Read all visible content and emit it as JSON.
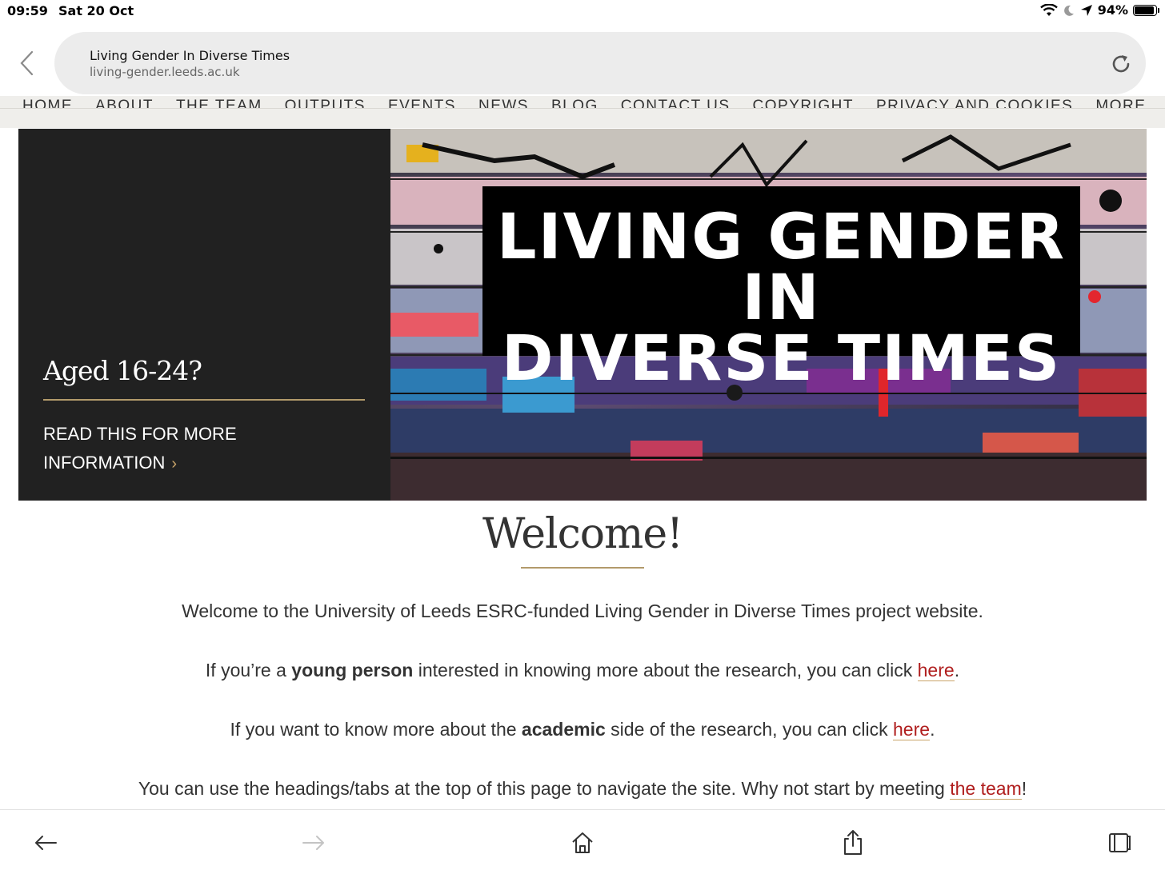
{
  "status_bar": {
    "time": "09:59",
    "date": "Sat 20 Oct",
    "battery": "94%",
    "battery_level": 0.94
  },
  "browser": {
    "page_title": "Living Gender In Diverse Times",
    "host": "living-gender.leeds.ac.uk"
  },
  "nav": {
    "items": [
      "HOME",
      "ABOUT",
      "THE TEAM",
      "OUTPUTS",
      "EVENTS",
      "NEWS",
      "BLOG",
      "CONTACT US",
      "COPYRIGHT",
      "PRIVACY AND COOKIES",
      "MORE"
    ]
  },
  "hero": {
    "aged": "Aged 16-24?",
    "cta_line1": "READ THIS FOR MORE",
    "cta_line2": "INFORMATION",
    "banner_line1": "LIVING GENDER IN",
    "banner_line2": "DIVERSE TIMES"
  },
  "welcome": {
    "title": "Welcome!",
    "p1": "Welcome to the University of Leeds ESRC-funded Living Gender in Diverse Times project website.",
    "p2_pre": "If you’re a ",
    "p2_bold": "young person",
    "p2_mid": " interested in knowing more about the research, you can click ",
    "p2_link": "here",
    "p2_post": ".",
    "p3_pre": "If you want to know more about the ",
    "p3_bold": "academic",
    "p3_mid": " side of the research, you can click ",
    "p3_link": "here",
    "p3_post": ".",
    "p4_pre": "You can use the headings/tabs at the top of this page to navigate the site. Why not start by meeting ",
    "p4_link": "the team",
    "p4_post": "!"
  },
  "colors": {
    "accent_gold": "#b29a6b",
    "link_red": "#b01e1e",
    "hero_dark": "#212121"
  }
}
